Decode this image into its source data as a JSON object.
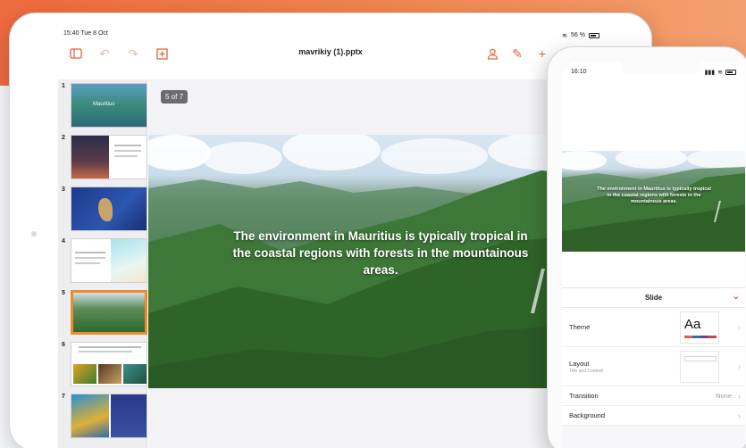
{
  "colors": {
    "accent": "#e1623c",
    "banner": "#ee6a3f",
    "thumb_active": "#f08a2c",
    "theme_palette": [
      "#e1623c",
      "#2d6fb5",
      "#7a3d9b",
      "#d0404a"
    ]
  },
  "ipad": {
    "status": {
      "time": "15:40",
      "date": "Tue 8 Oct",
      "battery": "56 %"
    },
    "toolbar": {
      "title": "mavrikiy (1).pptx",
      "icons": [
        "slides-panel-icon",
        "undo-icon",
        "redo-icon",
        "add-slide-icon",
        "user-icon",
        "pencil-icon",
        "plus-icon",
        "play-icon",
        "comment-icon"
      ]
    },
    "thumbnails": [
      {
        "num": "1",
        "label": "Mauritius"
      },
      {
        "num": "2",
        "label": ""
      },
      {
        "num": "3",
        "label": ""
      },
      {
        "num": "4",
        "label": ""
      },
      {
        "num": "5",
        "label": "",
        "active": true
      },
      {
        "num": "6",
        "label": ""
      },
      {
        "num": "7",
        "label": ""
      }
    ],
    "slide_counter": "5 of 7",
    "slide_text": "The environment in Mauritius is typically tropical in the coastal regions with forests in the mountainous areas."
  },
  "iphone": {
    "status_time": "16:10",
    "slide_text": "The environment in Mauritius is typically tropical in the coastal regions with forests in the mountainous areas.",
    "panel": {
      "title": "Slide",
      "rows": {
        "theme": {
          "label": "Theme",
          "preview": "Aa"
        },
        "layout": {
          "label": "Layout",
          "sub": "Title and Content"
        },
        "transition": {
          "label": "Transition",
          "value": "None"
        },
        "background": {
          "label": "Background"
        }
      }
    }
  }
}
